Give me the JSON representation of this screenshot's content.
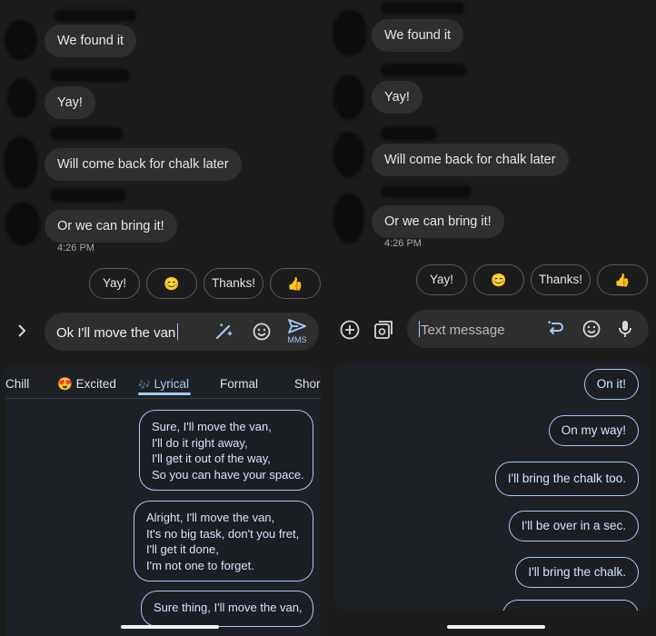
{
  "conversation": {
    "messages": [
      "We found it",
      "Yay!",
      "Will come back for chalk later",
      "Or we can bring it!"
    ],
    "timestamp": "4:26 PM"
  },
  "smart_replies": {
    "yay": "Yay!",
    "smile": "😊",
    "thanks": "Thanks!",
    "thumbs": "👍"
  },
  "left": {
    "compose_value": "Ok I'll move the van",
    "send_label": "MMS",
    "tabs": [
      {
        "label": "Chill"
      },
      {
        "label": "Excited",
        "emoji": "😍"
      },
      {
        "label": "Lyrical",
        "emoji": "🎶"
      },
      {
        "label": "Formal"
      },
      {
        "label": "Shor"
      }
    ],
    "active_tab": "Lyrical",
    "suggestions": [
      "Sure, I'll move the van,\nI'll do it right away,\nI'll get it out of the way,\nSo you can have your space.",
      "Alright, I'll move the van,\nIt's no big task, don't you fret,\nI'll get it done,\nI'm not one to forget.",
      "Sure thing, I'll move the van,"
    ]
  },
  "right": {
    "compose_placeholder": "Text message",
    "replies": [
      "On it!",
      "On my way!",
      "I'll bring the chalk too.",
      "I'll be over in a sec.",
      "I'll bring the chalk."
    ]
  },
  "colors": {
    "background": "#1b1b1b",
    "bubble": "#2f2f2f",
    "accent": "#a8c7fa",
    "compose": "#2e2e2e",
    "suggestion_panel": "#1d2125"
  },
  "icons": [
    "chevron-right-icon",
    "magic-pen-icon",
    "emoji-icon",
    "send-icon",
    "add-icon",
    "gallery-icon",
    "ai-rewrite-icon",
    "mic-icon"
  ]
}
